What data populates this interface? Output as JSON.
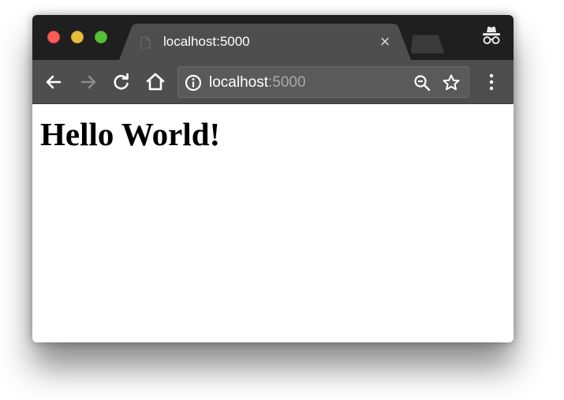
{
  "browser": {
    "tab": {
      "title": "localhost:5000",
      "close_glyph": "×",
      "favicon": "page-icon"
    },
    "omnibox": {
      "host": "localhost",
      "port": ":5000"
    },
    "icons": {
      "back": "arrow-left-icon",
      "forward": "arrow-right-icon",
      "reload": "reload-icon",
      "home": "home-icon",
      "info": "info-icon",
      "zoom": "zoom-icon",
      "bookmark": "star-icon",
      "menu": "kebab-menu-icon",
      "incognito": "incognito-icon"
    },
    "colors": {
      "titlebar": "#1f1f20",
      "tab": "#4e4e4e",
      "toolbar": "#4e4e4e",
      "close": "#fc5b57",
      "minimize": "#e5bf3c",
      "maximize": "#57c038"
    }
  },
  "page": {
    "heading": "Hello World!"
  }
}
